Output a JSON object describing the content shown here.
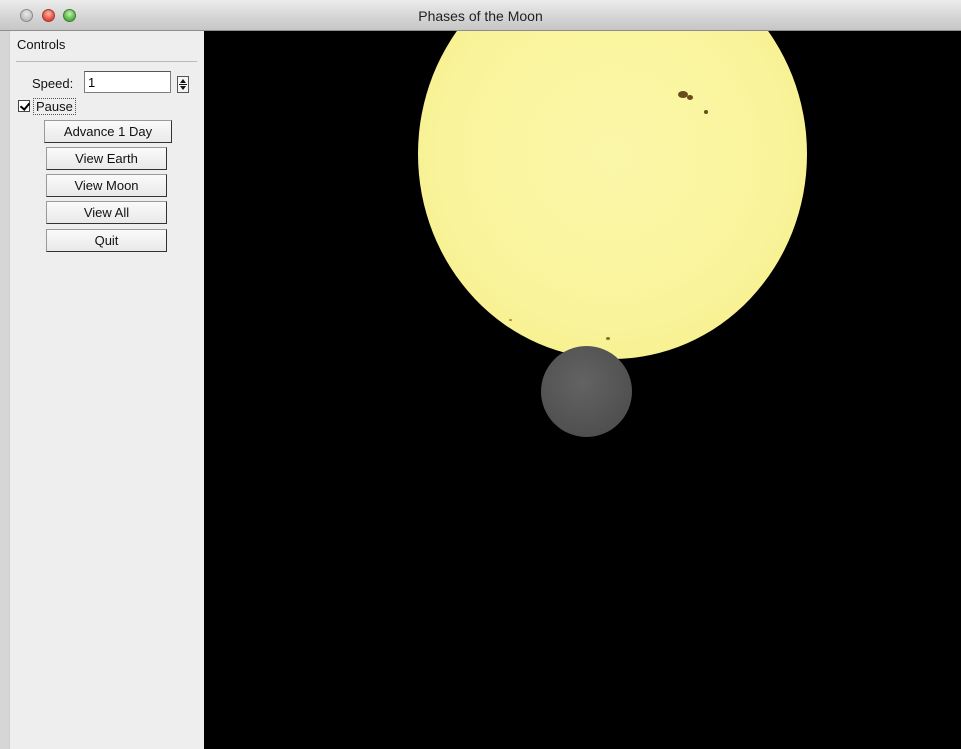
{
  "window": {
    "title": "Phases of the Moon"
  },
  "controls": {
    "heading": "Controls",
    "speed_label": "Speed:",
    "speed_value": "1",
    "pause_label": "Pause",
    "pause_checked": true,
    "buttons": {
      "advance": "Advance 1 Day",
      "view_earth": "View Earth",
      "view_moon": "View Moon",
      "view_all": "View All",
      "quit": "Quit"
    }
  },
  "scene": {
    "background_color": "#000000",
    "sun_color": "#f9f49b",
    "moon_color": "#555555",
    "sunspot_color": "#6b4a1c"
  }
}
